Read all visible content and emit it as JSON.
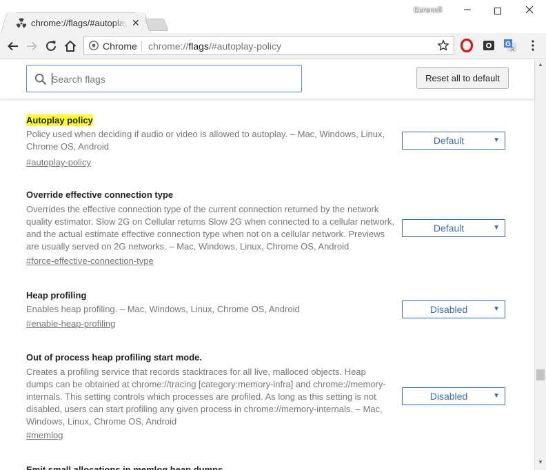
{
  "window": {
    "profile_name": "Евгений",
    "minimize_label": "—",
    "close_label": "✕"
  },
  "tab": {
    "title": "chrome://flags/#autoplay-policy",
    "close_label": "✕"
  },
  "toolbar": {
    "omnibox_origin": "Chrome",
    "url_scheme": "chrome://",
    "url_host": "flags",
    "url_path": "/#autoplay-policy"
  },
  "search": {
    "placeholder": "Search flags",
    "value": ""
  },
  "reset_button_label": "Reset all to default",
  "flags": [
    {
      "name": "Autoplay policy",
      "highlighted": true,
      "description": "Policy used when deciding if audio or video is allowed to autoplay. – Mac, Windows, Linux, Chrome OS, Android",
      "link": "#autoplay-policy",
      "selected": "Default"
    },
    {
      "name": "Override effective connection type",
      "highlighted": false,
      "description": "Overrides the effective connection type of the current connection returned by the network quality estimator. Slow 2G on Cellular returns Slow 2G when connected to a cellular network, and the actual estimate effective connection type when not on a cellular network. Previews are usually served on 2G networks. – Mac, Windows, Linux, Chrome OS, Android",
      "link": "#force-effective-connection-type",
      "selected": "Default"
    },
    {
      "name": "Heap profiling",
      "highlighted": false,
      "description": "Enables heap profiling. – Mac, Windows, Linux, Chrome OS, Android",
      "link": "#enable-heap-profiling",
      "selected": "Disabled"
    },
    {
      "name": "Out of process heap profiling start mode.",
      "highlighted": false,
      "description": "Creates a profiling service that records stacktraces for all live, malloced objects. Heap dumps can be obtained at chrome://tracing [category:memory-infra] and chrome://memory-internals. This setting controls which processes are profiled. As long as this setting is not disabled, users can start profiling any given process in chrome://memory-internals. – Mac, Windows, Linux, Chrome OS, Android",
      "link": "#memlog",
      "selected": "Disabled"
    },
    {
      "name": "Emit small allocations in memlog heap dumps."
    }
  ],
  "colors": {
    "highlight": "#ffff33",
    "select_accent": "#3b6db0",
    "search_border": "#5b8bc9",
    "opera_red": "#cc1a1a"
  },
  "icons": {
    "tab_favicon": "radiation-icon",
    "back": "arrow-left-icon",
    "forward": "arrow-right-icon",
    "reload": "reload-icon",
    "home": "home-icon",
    "site_info": "chrome-page-icon",
    "bookmark": "star-icon",
    "ext1": "opera-icon",
    "ext2": "screen-recorder-icon",
    "ext3": "google-translate-icon",
    "menu": "three-dots-menu-icon",
    "search": "search-icon"
  }
}
